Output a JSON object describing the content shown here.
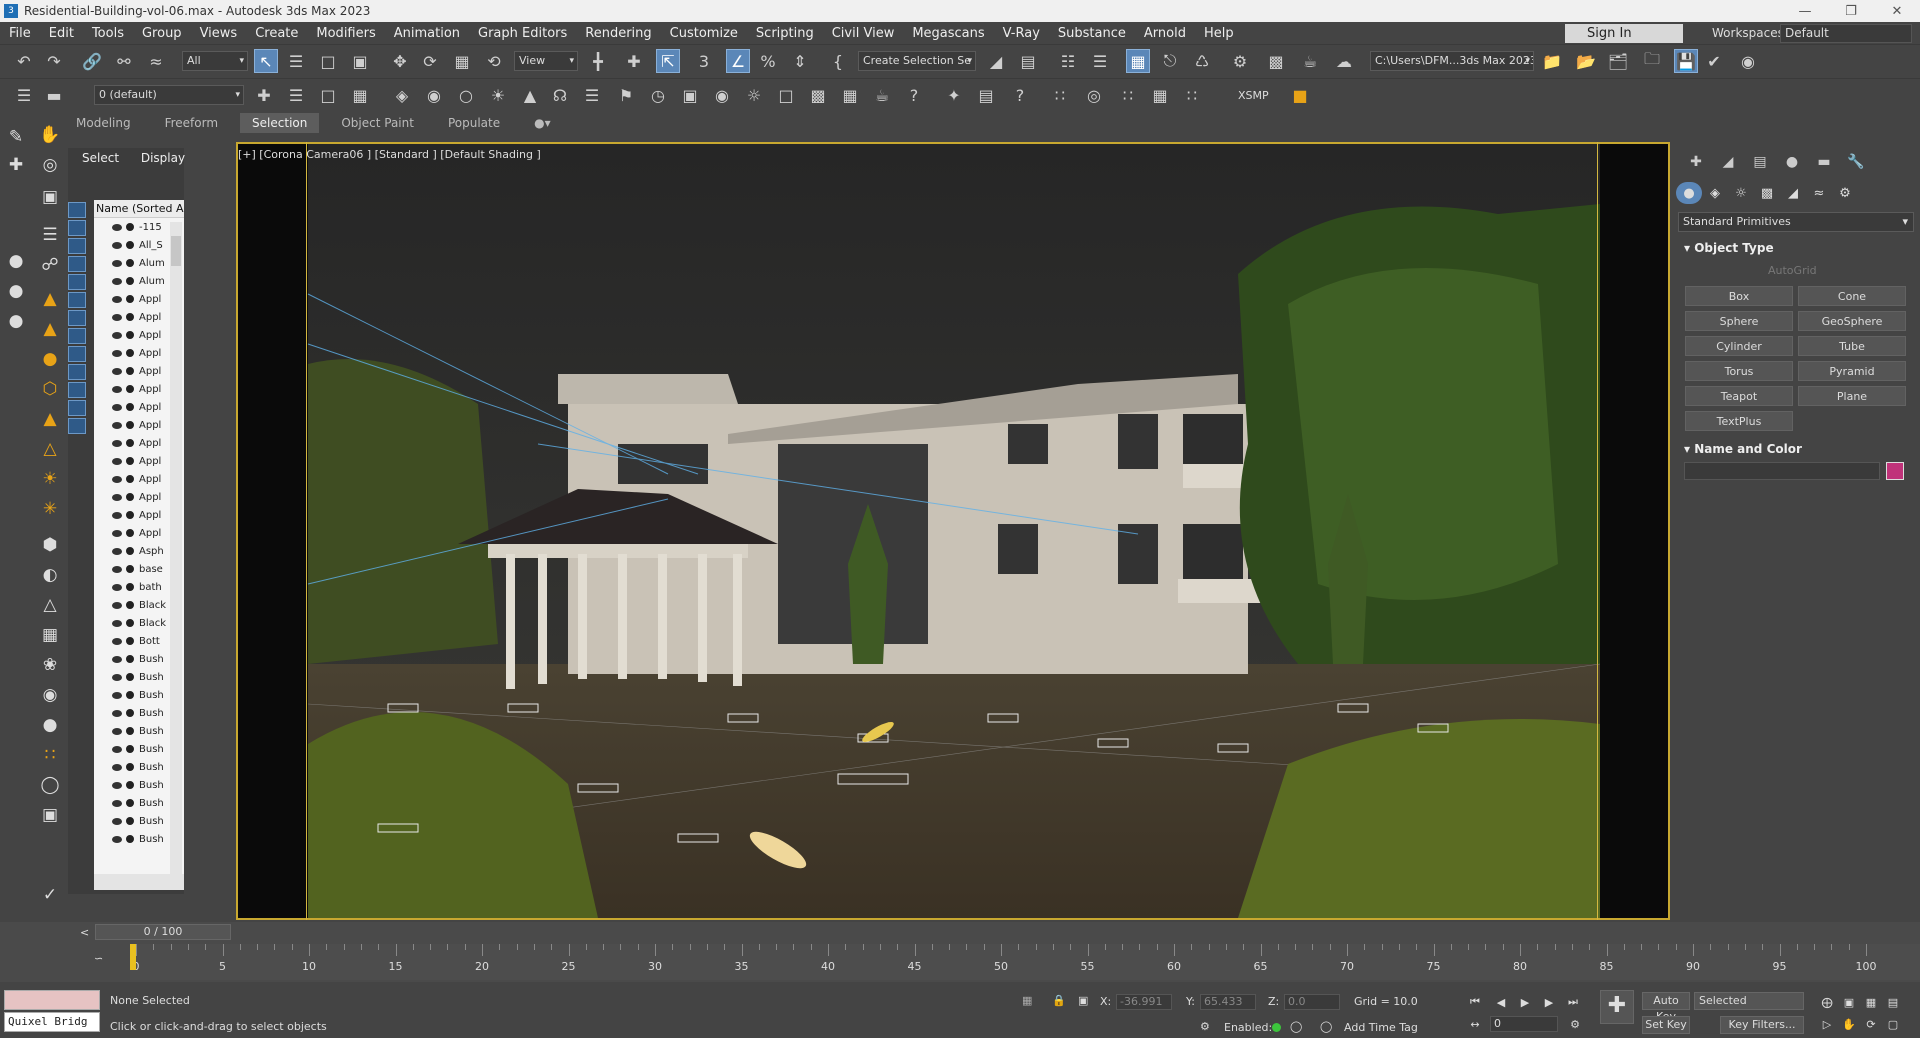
{
  "window": {
    "title": "Residential-Building-vol-06.max - Autodesk 3ds Max 2023"
  },
  "menu": [
    "File",
    "Edit",
    "Tools",
    "Group",
    "Views",
    "Create",
    "Modifiers",
    "Animation",
    "Graph Editors",
    "Rendering",
    "Customize",
    "Scripting",
    "Civil View",
    "Megascans",
    "V-Ray",
    "Substance",
    "Arnold",
    "Help"
  ],
  "account": {
    "sign_in": "Sign In",
    "workspaces_label": "Workspaces:",
    "workspace": "Default"
  },
  "toolbar": {
    "filter": "All",
    "ref_coord": "View",
    "selection_set": "Create Selection Se",
    "project_path": "C:\\Users\\DFM...3ds Max 2023",
    "layer": "0 (default)",
    "xsmp": "XSMP"
  },
  "ribbon_tabs": [
    {
      "label": "Modeling",
      "active": false
    },
    {
      "label": "Freeform",
      "active": false
    },
    {
      "label": "Selection",
      "active": true
    },
    {
      "label": "Object Paint",
      "active": false
    },
    {
      "label": "Populate",
      "active": false
    }
  ],
  "scene_explorer": {
    "tab_select": "Select",
    "tab_display": "Display",
    "column_header": "Name (Sorted Asce",
    "items": [
      "-115",
      "All_S",
      "Alum",
      "Alum",
      "Appl",
      "Appl",
      "Appl",
      "Appl",
      "Appl",
      "Appl",
      "Appl",
      "Appl",
      "Appl",
      "Appl",
      "Appl",
      "Appl",
      "Appl",
      "Appl",
      "Asph",
      "base",
      "bath",
      "Black",
      "Black",
      "Bott",
      "Bush",
      "Bush",
      "Bush",
      "Bush",
      "Bush",
      "Bush",
      "Bush",
      "Bush",
      "Bush",
      "Bush",
      "Bush"
    ]
  },
  "viewport": {
    "label": "[+] [Corona Camera06 ] [Standard ] [Default Shading ]"
  },
  "command_panel": {
    "category": "Standard Primitives",
    "object_type_header": "Object Type",
    "autogrid": "AutoGrid",
    "primitives": [
      "Box",
      "Cone",
      "Sphere",
      "GeoSphere",
      "Cylinder",
      "Tube",
      "Torus",
      "Pyramid",
      "Teapot",
      "Plane",
      "TextPlus"
    ],
    "name_color_header": "Name and Color",
    "object_color": "#c0337a"
  },
  "timeline": {
    "frame_display": "0 / 100",
    "ticks": [
      0,
      5,
      10,
      15,
      20,
      25,
      30,
      35,
      40,
      45,
      50,
      55,
      60,
      65,
      70,
      75,
      80,
      85,
      90,
      95,
      100
    ]
  },
  "status": {
    "selection": "None Selected",
    "prompt": "Click or click-and-drag to select objects",
    "maxscript": "Quixel Bridg",
    "x_label": "X:",
    "x_value": "-36.991",
    "y_label": "Y:",
    "y_value": "65.433",
    "z_label": "Z:",
    "z_value": "0.0",
    "grid": "Grid = 10.0",
    "enabled_label": "Enabled:",
    "add_time_tag": "Add Time Tag",
    "auto_key": "Auto Key",
    "set_key": "Set Key",
    "key_mode": "Selected",
    "key_filters": "Key Filters...",
    "current_frame": "0"
  }
}
